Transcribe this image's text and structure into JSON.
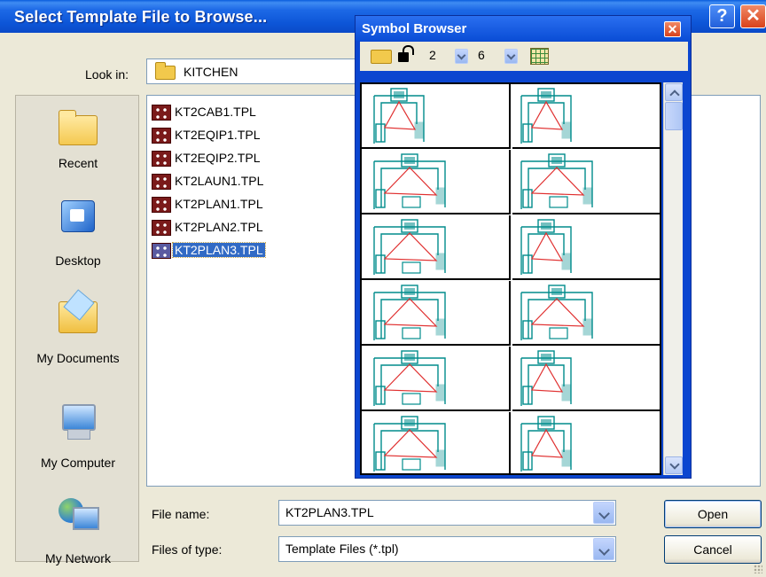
{
  "dialog": {
    "title": "Select Template File to Browse...",
    "help_btn": "?",
    "close_btn": "✕"
  },
  "look_in": {
    "label": "Look in:",
    "value": "KITCHEN",
    "icon": "folder-icon"
  },
  "places": [
    {
      "label": "Recent",
      "icon": "recent-folder-icon"
    },
    {
      "label": "Desktop",
      "icon": "desktop-icon"
    },
    {
      "label": "My Documents",
      "icon": "my-documents-icon"
    },
    {
      "label": "My Computer",
      "icon": "my-computer-icon"
    },
    {
      "label": "My Network",
      "icon": "my-network-icon"
    }
  ],
  "files": [
    {
      "name": "KT2CAB1.TPL"
    },
    {
      "name": "KT2EQIP1.TPL"
    },
    {
      "name": "KT2EQIP2.TPL"
    },
    {
      "name": "KT2LAUN1.TPL"
    },
    {
      "name": "KT2PLAN1.TPL"
    },
    {
      "name": "KT2PLAN2.TPL"
    },
    {
      "name": "KT2PLAN3.TPL",
      "selected": true
    }
  ],
  "file_name": {
    "label": "File name:",
    "value": "KT2PLAN3.TPL"
  },
  "file_type": {
    "label": "Files of type:",
    "value": "Template Files (*.tpl)"
  },
  "buttons": {
    "open": "Open",
    "cancel": "Cancel"
  },
  "symbol_browser": {
    "title": "Symbol Browser",
    "close_btn": "✕",
    "columns_value": "2",
    "rows_value": "6",
    "toolbar_icons": [
      "folder-icon",
      "unlock-icon",
      "grid-icon"
    ],
    "thumbnail_count": 12,
    "colors": {
      "plan": "#008c8c",
      "triangle": "#e03030"
    }
  }
}
